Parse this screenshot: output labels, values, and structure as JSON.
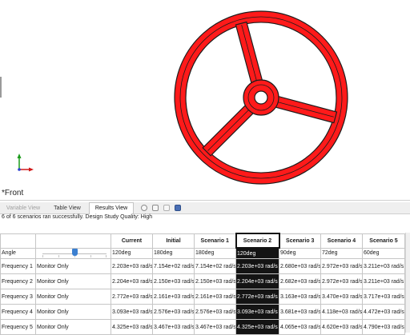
{
  "viewport": {
    "view_label": "*Front",
    "triad_axes": {
      "y": "Y",
      "x": "X",
      "z": "Z"
    },
    "model_color": "#ff1a1a",
    "outline_color": "#1c1c1c"
  },
  "panel": {
    "tabs": [
      {
        "label": "Variable View",
        "state": "disabled"
      },
      {
        "label": "Table View",
        "state": "normal"
      },
      {
        "label": "Results View",
        "state": "active"
      }
    ],
    "toolbar_icons": [
      "gear-icon",
      "table-icon",
      "run-icon",
      "save-icon"
    ],
    "status_text": "6 of 6 scenarios ran successfully. Design Study Quality: High",
    "table": {
      "headers": [
        "",
        "",
        "Current",
        "Initial",
        "Scenario 1",
        "Scenario 2",
        "Scenario 3",
        "Scenario 4",
        "Scenario 5"
      ],
      "selected_column": "Scenario 2",
      "angle_row": {
        "label": "Angle",
        "values": [
          "120deg",
          "180deg",
          "180deg",
          "120deg",
          "90deg",
          "72deg",
          "60deg"
        ],
        "slider_fraction": 0.5
      },
      "rows": [
        {
          "label": "Frequency 1",
          "goal": "Monitor Only",
          "values": [
            "2.203e+03 rad/s",
            "7.154e+02 rad/s",
            "7.154e+02 rad/s",
            "2.203e+03 rad/s",
            "2.680e+03 rad/s",
            "2.972e+03 rad/s",
            "3.211e+03 rad/s"
          ]
        },
        {
          "label": "Frequency 2",
          "goal": "Monitor Only",
          "values": [
            "2.204e+03 rad/s",
            "2.150e+03 rad/s",
            "2.150e+03 rad/s",
            "2.204e+03 rad/s",
            "2.682e+03 rad/s",
            "2.972e+03 rad/s",
            "3.211e+03 rad/s"
          ]
        },
        {
          "label": "Frequency 3",
          "goal": "Monitor Only",
          "values": [
            "2.772e+03 rad/s",
            "2.161e+03 rad/s",
            "2.161e+03 rad/s",
            "2.772e+03 rad/s",
            "3.163e+03 rad/s",
            "3.470e+03 rad/s",
            "3.717e+03 rad/s"
          ]
        },
        {
          "label": "Frequency 4",
          "goal": "Monitor Only",
          "values": [
            "3.093e+03 rad/s",
            "2.576e+03 rad/s",
            "2.576e+03 rad/s",
            "3.093e+03 rad/s",
            "3.681e+03 rad/s",
            "4.118e+03 rad/s",
            "4.472e+03 rad/s"
          ]
        },
        {
          "label": "Frequency 5",
          "goal": "Monitor Only",
          "values": [
            "4.325e+03 rad/s",
            "3.467e+03 rad/s",
            "3.467e+03 rad/s",
            "4.325e+03 rad/s",
            "4.065e+03 rad/s",
            "4.620e+03 rad/s",
            "4.790e+03 rad/s"
          ]
        }
      ]
    }
  }
}
